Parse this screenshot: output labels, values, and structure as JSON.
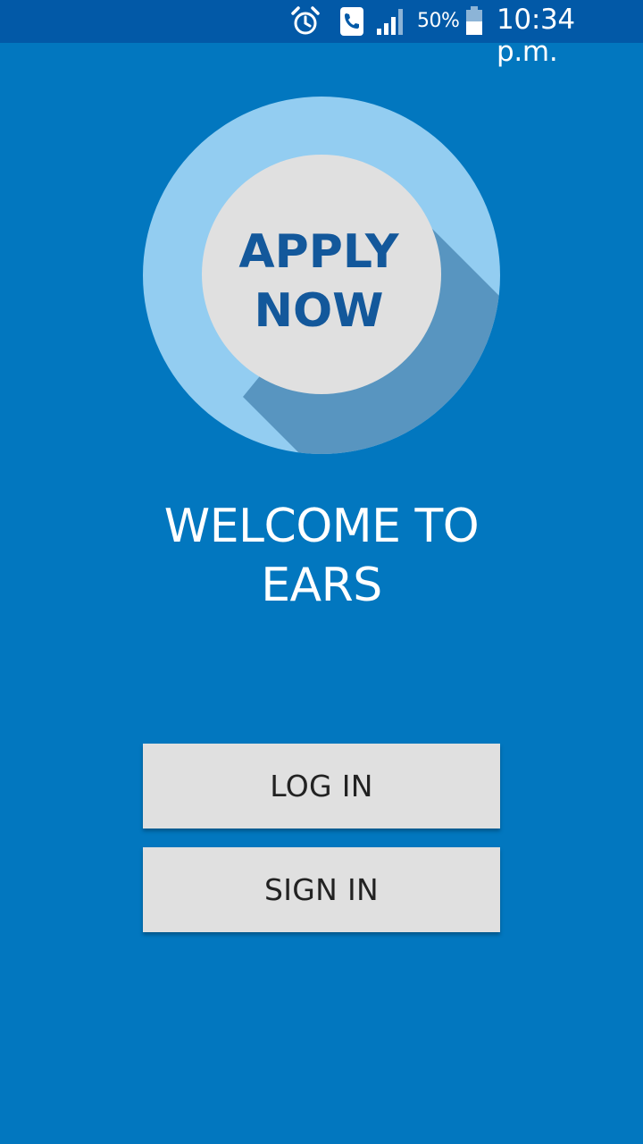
{
  "status_bar": {
    "battery_percent": "50%",
    "time": "10:34 p.m.",
    "icons": [
      "alarm-icon",
      "phone-call-icon",
      "signal-icon",
      "battery-icon"
    ]
  },
  "logo": {
    "line1": "APPLY",
    "line2": "NOW",
    "colors": {
      "outer_ring": "#93cdf1",
      "shadow": "#5895c0",
      "inner_circle": "#e0e0e0",
      "text": "#13589b"
    }
  },
  "welcome": {
    "line1": "WELCOME TO",
    "line2": "EARS"
  },
  "buttons": {
    "login_label": "LOG IN",
    "signin_label": "SIGN IN"
  },
  "colors": {
    "background": "#0277bf",
    "status_bar": "#0259a7",
    "button_bg": "#e0e0e0",
    "button_text": "#222222"
  }
}
